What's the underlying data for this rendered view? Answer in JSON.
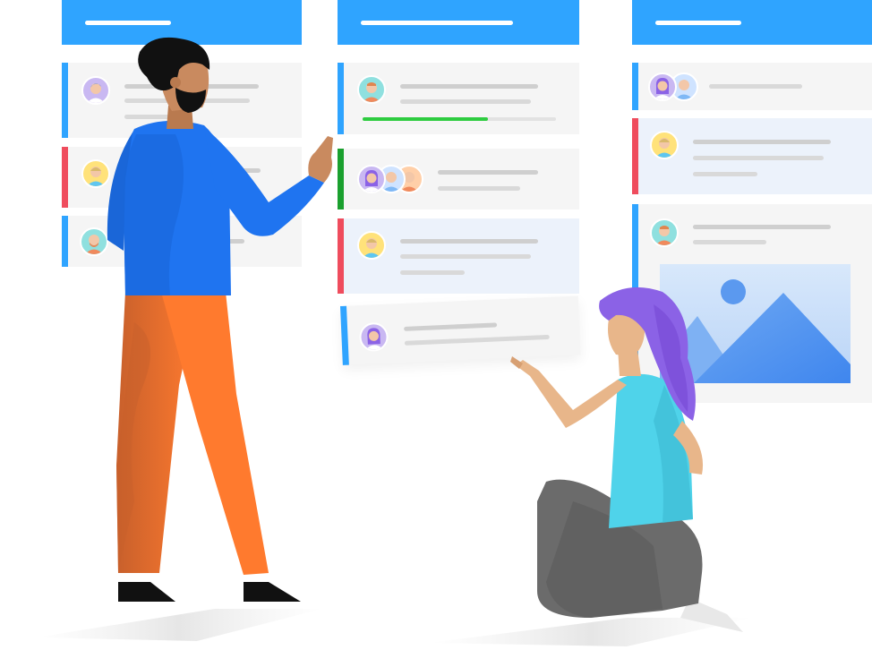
{
  "colors": {
    "header": "#2fa4ff",
    "accent_blue": "#2fa4ff",
    "accent_red": "#ef4c5d",
    "accent_green": "#1aa02e",
    "progress": "#2ecc40",
    "card_background": "#f5f5f5",
    "card_tinted_background": "#ecf2fb",
    "man_shirt": "#1f74f0",
    "man_pants": "#ff7a2e",
    "woman_shirt": "#4fd3ea",
    "woman_hair": "#8b62e6",
    "woman_pants": "#6b6b6b"
  },
  "board": {
    "columns": [
      {
        "name": "column-left",
        "cards": [
          {
            "accent": "blue",
            "avatars": [
              "avatar-violet"
            ]
          },
          {
            "accent": "red",
            "avatars": [
              "avatar-yellow"
            ]
          },
          {
            "accent": "blue",
            "avatars": [
              "avatar-teal"
            ]
          }
        ]
      },
      {
        "name": "column-middle",
        "cards": [
          {
            "accent": "blue",
            "avatars": [
              "avatar-teal"
            ],
            "progress": 0.65
          },
          {
            "accent": "green",
            "avatars": [
              "avatar-violet",
              "avatar-blue",
              "avatar-peach"
            ]
          },
          {
            "accent": "red",
            "avatars": [
              "avatar-yellow"
            ]
          },
          {
            "accent": "blue",
            "avatars": [
              "avatar-violet"
            ]
          }
        ]
      },
      {
        "name": "column-right",
        "cards": [
          {
            "accent": "blue",
            "avatars": [
              "avatar-violet",
              "avatar-blue"
            ]
          },
          {
            "accent": "red",
            "avatars": [
              "avatar-yellow"
            ]
          },
          {
            "accent": "blue",
            "avatars": [
              "avatar-teal"
            ],
            "attachment": "image-placeholder-icon"
          }
        ]
      }
    ]
  },
  "people": [
    "man-figure",
    "woman-figure"
  ]
}
